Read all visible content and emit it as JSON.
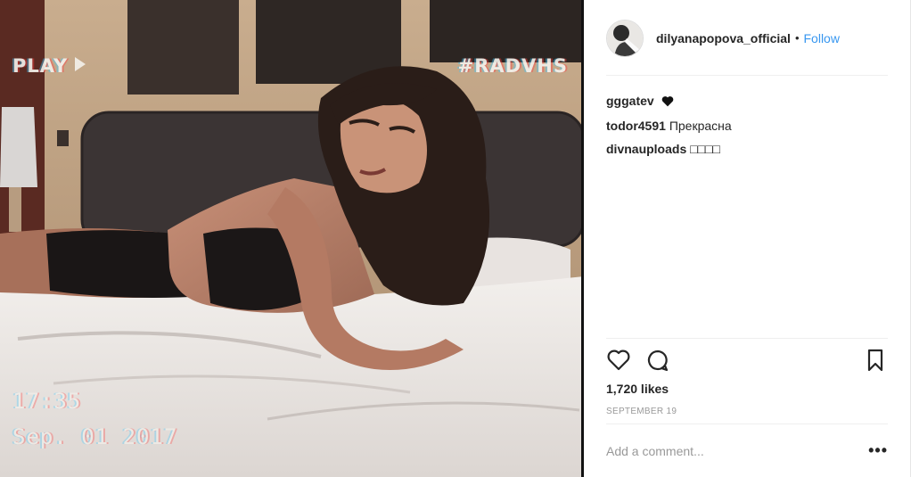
{
  "photo": {
    "overlay_play": "PLAY",
    "overlay_tag": "#RADVHS",
    "overlay_time": "17:35",
    "overlay_date": "Sep. 01 2017"
  },
  "header": {
    "username": "dilyanapopova_official",
    "separator": "•",
    "follow_label": "Follow"
  },
  "comments": [
    {
      "user": "gggatev",
      "text": "",
      "icon": "heart-icon"
    },
    {
      "user": "todor4591",
      "text": "Прекрасна"
    },
    {
      "user": "divnauploads",
      "text": "□□□□"
    }
  ],
  "stats": {
    "likes": "1,720 likes",
    "date": "SEPTEMBER 19"
  },
  "comment_box": {
    "placeholder": "Add a comment..."
  },
  "more_label": "•••",
  "colors": {
    "link": "#3897f0",
    "text": "#262626",
    "muted": "#999999",
    "divider": "#efefef"
  }
}
